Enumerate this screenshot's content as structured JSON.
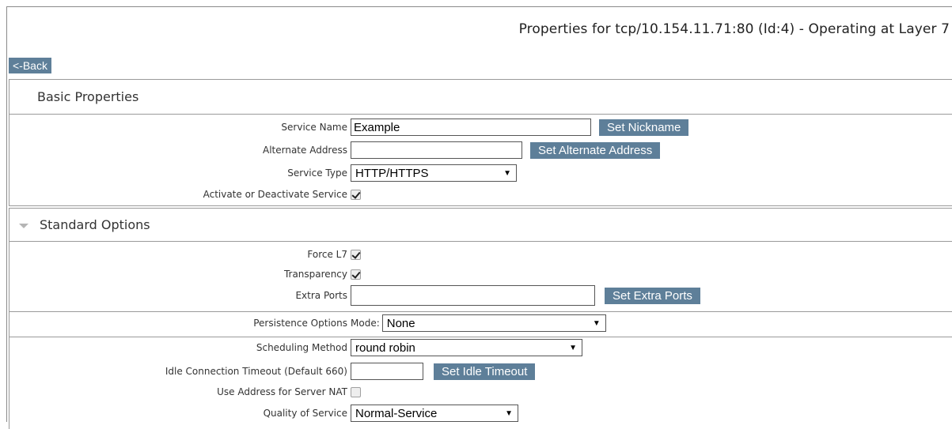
{
  "page": {
    "title": "Properties for tcp/10.154.11.71:80 (Id:4) - Operating at Layer 7",
    "back_label": "<-Back"
  },
  "basic": {
    "header": "Basic Properties",
    "service_name": {
      "label": "Service Name",
      "value": "Example",
      "button": "Set Nickname"
    },
    "alternate_address": {
      "label": "Alternate Address",
      "value": "",
      "button": "Set Alternate Address"
    },
    "service_type": {
      "label": "Service Type",
      "value": "HTTP/HTTPS"
    },
    "activate": {
      "label": "Activate or Deactivate Service",
      "checked": true
    }
  },
  "standard": {
    "header": "Standard Options",
    "force_l7": {
      "label": "Force L7",
      "checked": true
    },
    "transparency": {
      "label": "Transparency",
      "checked": true
    },
    "extra_ports": {
      "label": "Extra Ports",
      "value": "",
      "button": "Set Extra Ports"
    },
    "persistence": {
      "label": "Persistence Options",
      "mode_label": "Mode:",
      "value": "None"
    },
    "scheduling": {
      "label": "Scheduling Method",
      "value": "round robin"
    },
    "idle_timeout": {
      "label": "Idle Connection Timeout (Default 660)",
      "value": "",
      "button": "Set Idle Timeout"
    },
    "server_nat": {
      "label": "Use Address for Server NAT",
      "checked": false
    },
    "qos": {
      "label": "Quality of Service",
      "value": "Normal-Service"
    }
  },
  "colors": {
    "button_bg": "#5e7f99",
    "border": "#9a9a9a"
  }
}
